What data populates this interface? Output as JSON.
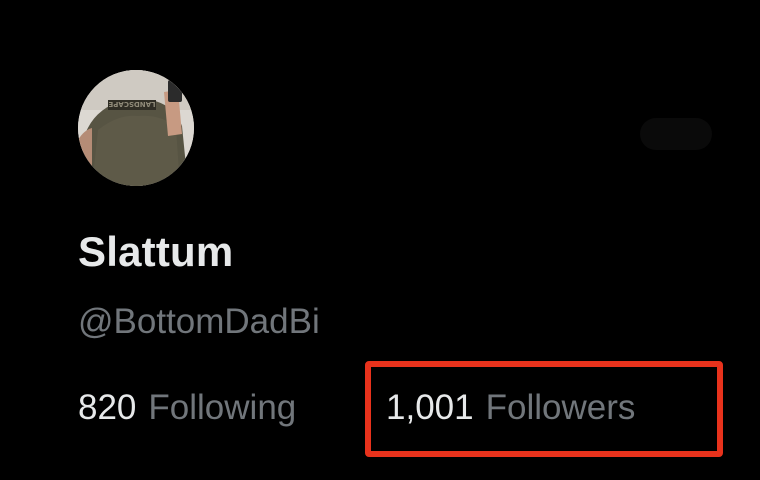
{
  "profile": {
    "display_name": "Slattum",
    "handle": "@BottomDadBi",
    "avatar_shirt_text": "LANDSCAPE",
    "following_count": "820",
    "following_label": "Following",
    "followers_count": "1,001",
    "followers_label": "Followers"
  },
  "colors": {
    "background": "#000000",
    "primary_text": "#e7e9ea",
    "secondary_text": "#71767b",
    "highlight_box": "#e8321c"
  },
  "icons": {
    "avatar": "user-photo",
    "faint_top_right": "ghost-icon"
  }
}
